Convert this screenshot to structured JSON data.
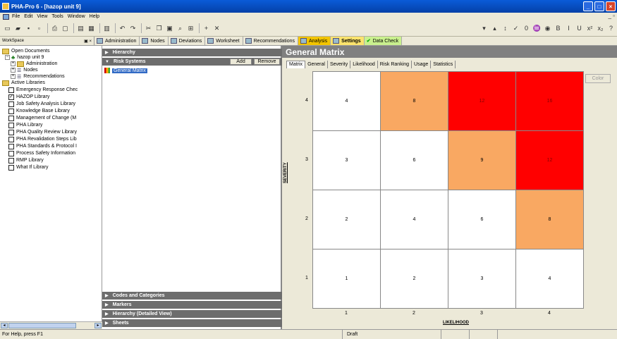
{
  "window": {
    "title": "PHA-Pro 6 - [hazop unit 9]",
    "buttons": {
      "minimize": "_",
      "maximize": "□",
      "close": "×"
    }
  },
  "menu": {
    "items": [
      "File",
      "Edit",
      "View",
      "Tools",
      "Window",
      "Help"
    ],
    "mdi_controls": "_ ▫"
  },
  "toolbar": {
    "icons": [
      "new-icon",
      "open-icon",
      "save-icon",
      "save-all-icon",
      "print-icon",
      "preview-icon",
      "properties-icon",
      "grid-icon",
      "table-icon",
      "undo-icon",
      "redo-icon",
      "cut-icon",
      "copy-icon",
      "paste-icon",
      "find-icon",
      "link-icon",
      "insert-row-icon",
      "delete-row-icon"
    ],
    "right_icons": [
      "filter-down-icon",
      "filter-up-icon",
      "sort-icon",
      "check-icon",
      "zero-icon",
      "spell-icon",
      "binoculars-icon",
      "bold-icon",
      "italic-icon",
      "underline-icon",
      "superscript-icon",
      "subscript-icon",
      "help-icon"
    ]
  },
  "workspace": {
    "label": "WorkSpace",
    "controls": "▣ ×"
  },
  "top_tabs": [
    {
      "label": "Administration",
      "style": "normal"
    },
    {
      "label": "Nodes",
      "style": "normal"
    },
    {
      "label": "Deviations",
      "style": "normal"
    },
    {
      "label": "Worksheet",
      "style": "normal"
    },
    {
      "label": "Recommendations",
      "style": "normal"
    },
    {
      "label": "Analysis",
      "style": "analysis"
    },
    {
      "label": "Settings",
      "style": "settings"
    },
    {
      "label": "Data Check",
      "style": "datacheck"
    }
  ],
  "tree": {
    "open_documents": "Open Documents",
    "document": "hazop unit 9",
    "doc_children": [
      "Administration",
      "Nodes",
      "Recommendations"
    ],
    "active_libraries": "Active Libraries",
    "libraries": [
      {
        "label": "Emergency Response Chec",
        "checked": false
      },
      {
        "label": "HAZOP Library",
        "checked": true
      },
      {
        "label": "Job Safety Analysis Library",
        "checked": false
      },
      {
        "label": "Knowledge Base Library",
        "checked": false
      },
      {
        "label": "Management of Change (M",
        "checked": false
      },
      {
        "label": "PHA Library",
        "checked": false
      },
      {
        "label": "PHA Quality Review Library",
        "checked": false
      },
      {
        "label": "PHA Revalidation Steps Lib",
        "checked": false
      },
      {
        "label": "PHA Standards & Protocol I",
        "checked": false
      },
      {
        "label": "Process Safety Information",
        "checked": false
      },
      {
        "label": "RMP Library",
        "checked": false
      },
      {
        "label": "What If Library",
        "checked": false
      }
    ]
  },
  "middle": {
    "sections_top": [
      "Hierarchy",
      "Risk Systems"
    ],
    "add_label": "Add",
    "remove_label": "Remove",
    "selected_item": "General Matrix",
    "sections_bottom": [
      "Codes and Categories",
      "Markers",
      "Hierarchy (Detailed View)",
      "Sheets"
    ]
  },
  "matrix_panel": {
    "title": "General Matrix",
    "tabs": [
      "Matrix",
      "General",
      "Severity",
      "Likelihood",
      "Risk Ranking",
      "Usage",
      "Statistics"
    ],
    "active_tab": "Matrix",
    "color_button": "Color",
    "severity_label": "SEVERITY",
    "likelihood_label": "LIKELIHOOD",
    "severity_levels": [
      "4",
      "3",
      "2",
      "1"
    ],
    "likelihood_levels": [
      "1",
      "2",
      "3",
      "4"
    ],
    "cells": [
      [
        "4",
        "8",
        "12",
        "16"
      ],
      [
        "3",
        "6",
        "9",
        "12"
      ],
      [
        "2",
        "4",
        "6",
        "8"
      ],
      [
        "1",
        "2",
        "3",
        "4"
      ]
    ],
    "cell_colors": [
      [
        "#ffffff",
        "#f9a862",
        "#ff0000",
        "#ff0000"
      ],
      [
        "#ffffff",
        "#ffffff",
        "#f9a862",
        "#ff0000"
      ],
      [
        "#ffffff",
        "#ffffff",
        "#ffffff",
        "#f9a862"
      ],
      [
        "#ffffff",
        "#ffffff",
        "#ffffff",
        "#ffffff"
      ]
    ]
  },
  "status": {
    "help": "For Help, press F1",
    "mode": "Draft"
  }
}
